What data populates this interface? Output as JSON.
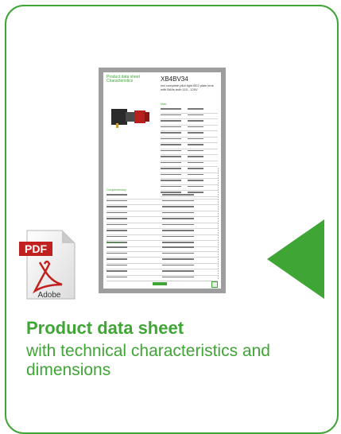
{
  "card": {
    "title": "Product data sheet",
    "description": "with technical characteristics and dimensions"
  },
  "document": {
    "header_left": "Product data sheet\nCharacteristics",
    "product_code": "XB4BV34",
    "product_description": "red complete pilot light Ø22 plain lens with BA9s bulb 110...120V",
    "sections": [
      "Main",
      "Complementary",
      "Environment"
    ]
  },
  "pdf_icon": {
    "label": "PDF",
    "brand": "Adobe"
  },
  "icons": {
    "document": "pdf-document-icon",
    "action": "play-arrow-icon"
  },
  "colors": {
    "accent": "#3fa535",
    "pdf_red": "#c0211f",
    "frame": "#9e9e9e"
  }
}
